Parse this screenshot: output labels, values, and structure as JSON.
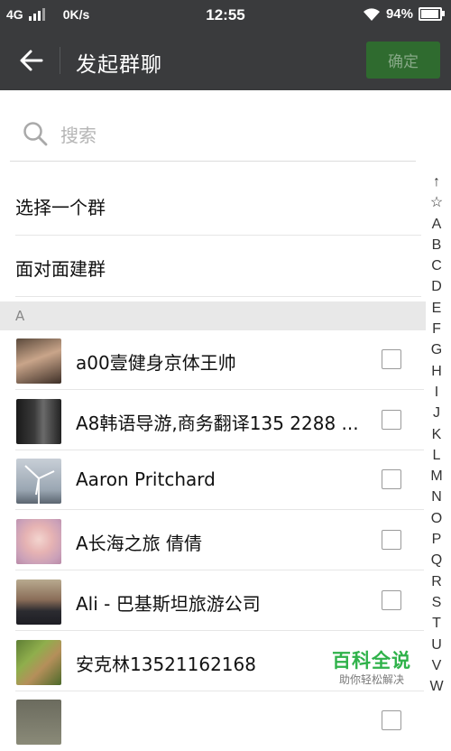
{
  "status_bar": {
    "network": "4G",
    "speed": "0K/s",
    "time": "12:55",
    "battery": "94%"
  },
  "title_bar": {
    "back_icon": "arrow-left-icon",
    "title": "发起群聊",
    "confirm_label": "确定"
  },
  "search": {
    "icon": "search-icon",
    "placeholder": "搜索"
  },
  "options": [
    {
      "label": "选择一个群"
    },
    {
      "label": "面对面建群"
    }
  ],
  "section": {
    "letter": "A"
  },
  "contacts": [
    {
      "name": "a00壹健身京体王帅"
    },
    {
      "name": "A8韩语导游,商务翻译135 2288 ..."
    },
    {
      "name": "Aaron Pritchard"
    },
    {
      "name": "A长海之旅 倩倩"
    },
    {
      "name": "Ali - 巴基斯坦旅游公司"
    },
    {
      "name": "安克林13521162168"
    }
  ],
  "index_letters": [
    "↑",
    "☆",
    "A",
    "B",
    "C",
    "D",
    "E",
    "F",
    "G",
    "H",
    "I",
    "J",
    "K",
    "L",
    "M",
    "N",
    "O",
    "P",
    "Q",
    "R",
    "S",
    "T",
    "U",
    "V",
    "W"
  ],
  "watermark": {
    "main": "百科全说",
    "sub": "助你轻松解决"
  },
  "colors": {
    "header_bg": "#3a3b3d",
    "confirm_bg": "#2f6b2f",
    "watermark_green": "#2fb24a"
  }
}
